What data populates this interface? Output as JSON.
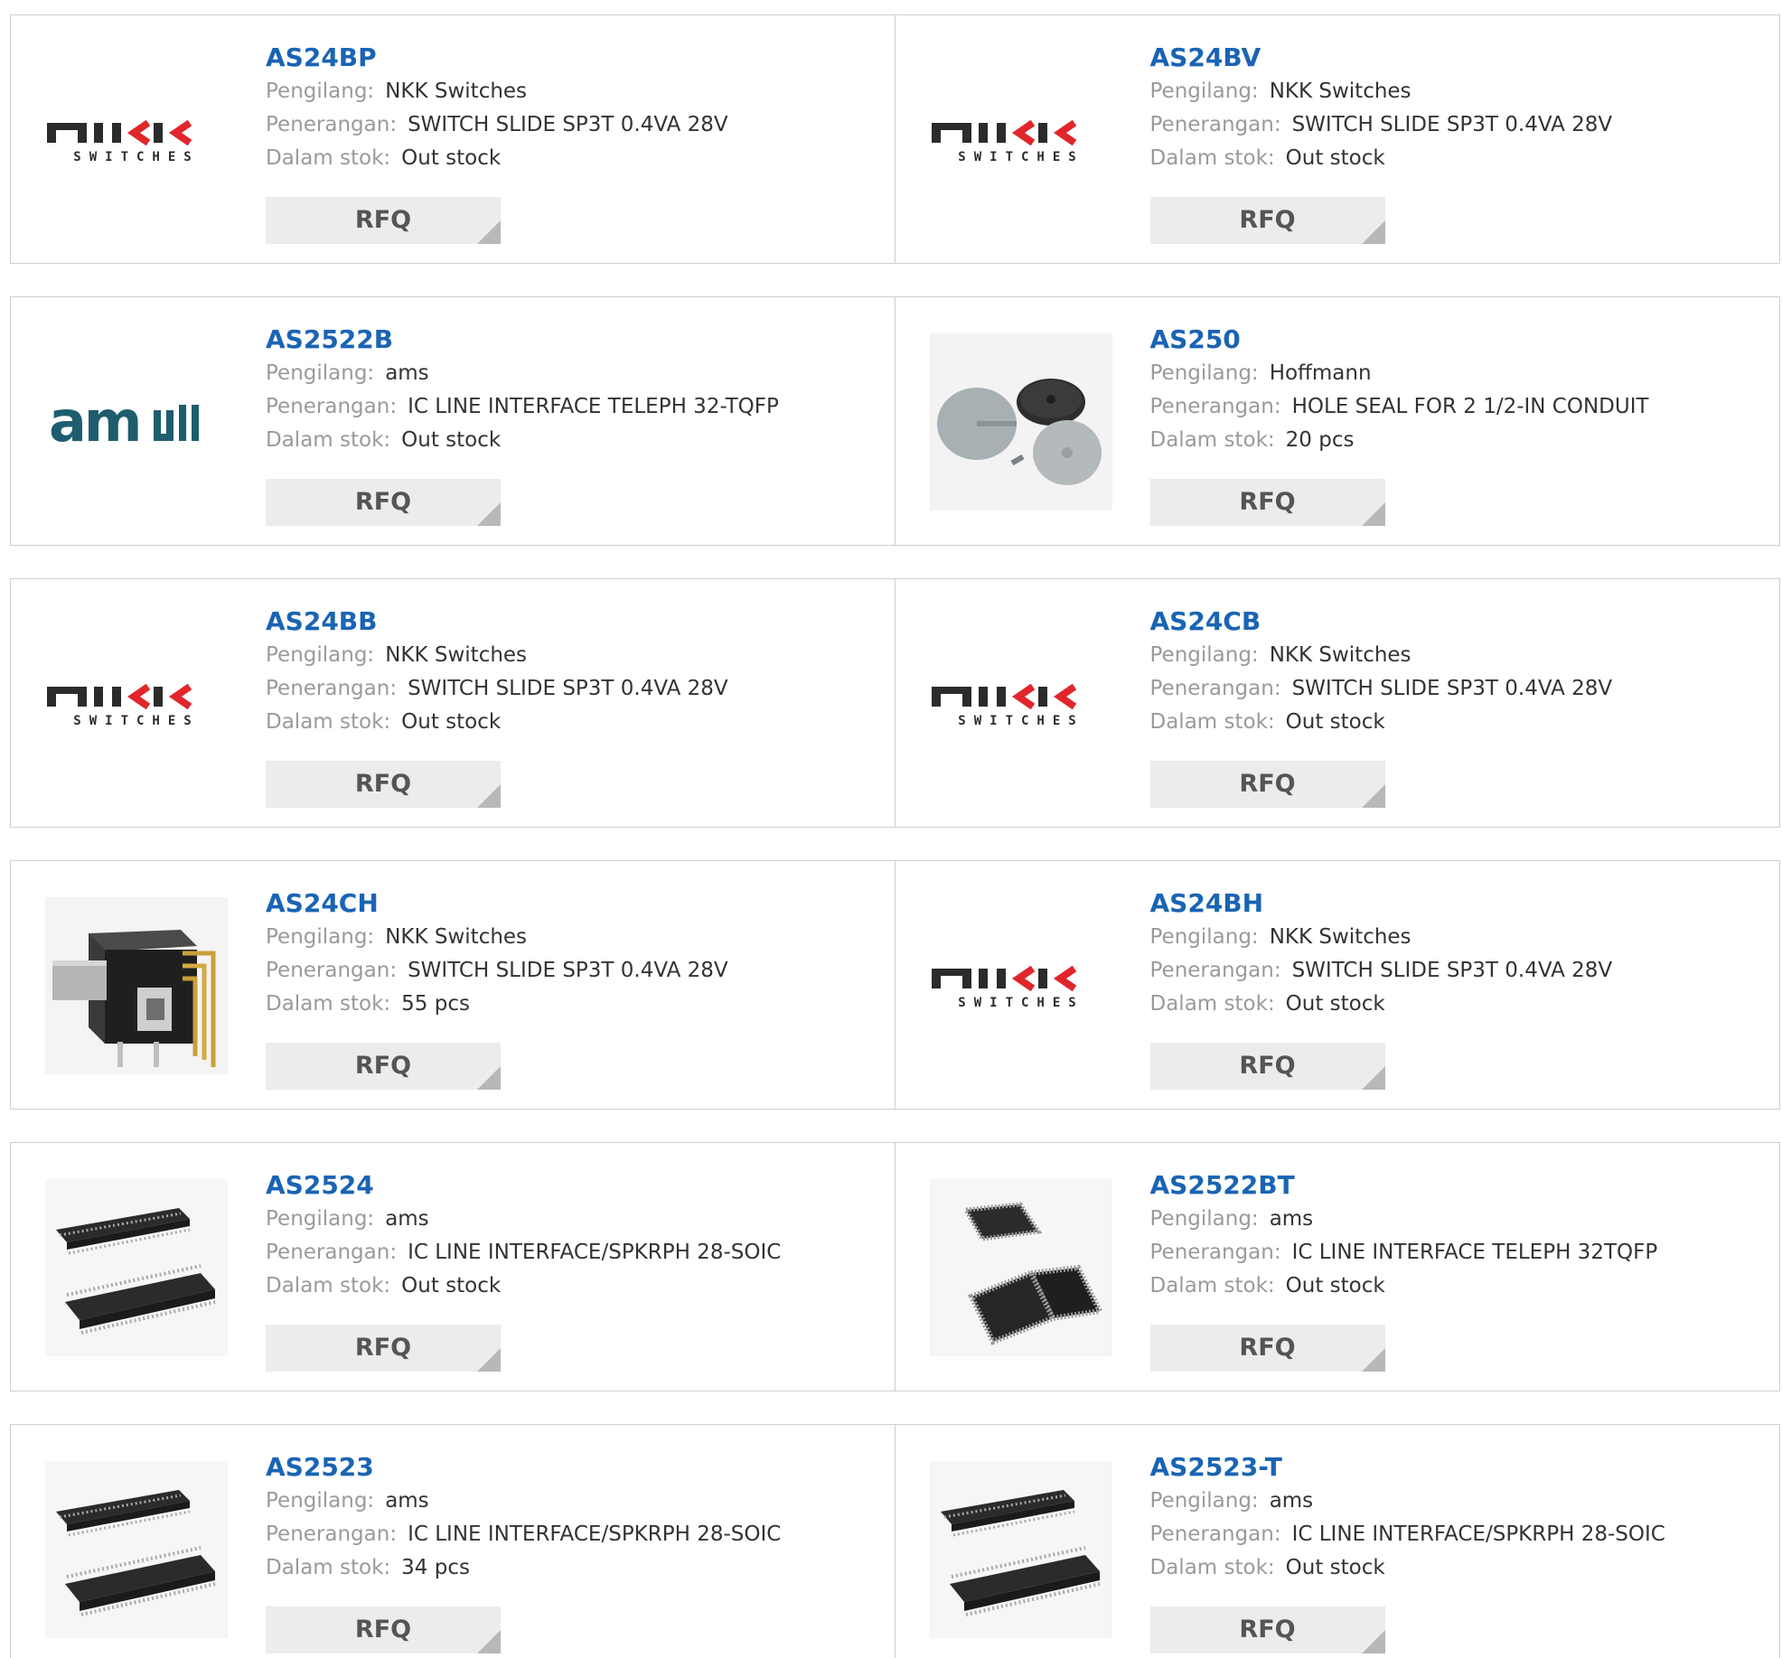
{
  "labels": {
    "manufacturer": "Pengilang:",
    "description": "Penerangan:",
    "stock": "Dalam stok:",
    "rfq": "RFQ"
  },
  "colors": {
    "part_link": "#1a64b4",
    "label": "#9a9a9a",
    "value": "#333333",
    "rfq_bg": "#ececec",
    "border": "#cfcfcf"
  },
  "products": [
    {
      "part": "AS24BP",
      "manufacturer": "NKK Switches",
      "description": "SWITCH SLIDE SP3T 0.4VA 28V",
      "stock": "Out stock",
      "image": "nkk-logo"
    },
    {
      "part": "AS24BV",
      "manufacturer": "NKK Switches",
      "description": "SWITCH SLIDE SP3T 0.4VA 28V",
      "stock": "Out stock",
      "image": "nkk-logo"
    },
    {
      "part": "AS2522B",
      "manufacturer": "ams",
      "description": "IC LINE INTERFACE TELEPH 32-TQFP",
      "stock": "Out stock",
      "image": "ams-logo"
    },
    {
      "part": "AS250",
      "manufacturer": "Hoffmann",
      "description": "HOLE SEAL FOR 2 1/2-IN CONDUIT",
      "stock": "20 pcs",
      "image": "hole-seal-photo"
    },
    {
      "part": "AS24BB",
      "manufacturer": "NKK Switches",
      "description": "SWITCH SLIDE SP3T 0.4VA 28V",
      "stock": "Out stock",
      "image": "nkk-logo"
    },
    {
      "part": "AS24CB",
      "manufacturer": "NKK Switches",
      "description": "SWITCH SLIDE SP3T 0.4VA 28V",
      "stock": "Out stock",
      "image": "nkk-logo"
    },
    {
      "part": "AS24CH",
      "manufacturer": "NKK Switches",
      "description": "SWITCH SLIDE SP3T 0.4VA 28V",
      "stock": "55 pcs",
      "image": "slide-switch-photo"
    },
    {
      "part": "AS24BH",
      "manufacturer": "NKK Switches",
      "description": "SWITCH SLIDE SP3T 0.4VA 28V",
      "stock": "Out stock",
      "image": "nkk-logo"
    },
    {
      "part": "AS2524",
      "manufacturer": "ams",
      "description": "IC LINE INTERFACE/SPKRPH 28-SOIC",
      "stock": "Out stock",
      "image": "soic-chip-photo"
    },
    {
      "part": "AS2522BT",
      "manufacturer": "ams",
      "description": "IC LINE INTERFACE TELEPH 32TQFP",
      "stock": "Out stock",
      "image": "tqfp-chip-photo"
    },
    {
      "part": "AS2523",
      "manufacturer": "ams",
      "description": "IC LINE INTERFACE/SPKRPH 28-SOIC",
      "stock": "34 pcs",
      "image": "soic-chip-photo"
    },
    {
      "part": "AS2523-T",
      "manufacturer": "ams",
      "description": "IC LINE INTERFACE/SPKRPH 28-SOIC",
      "stock": "Out stock",
      "image": "soic-chip-photo"
    }
  ]
}
